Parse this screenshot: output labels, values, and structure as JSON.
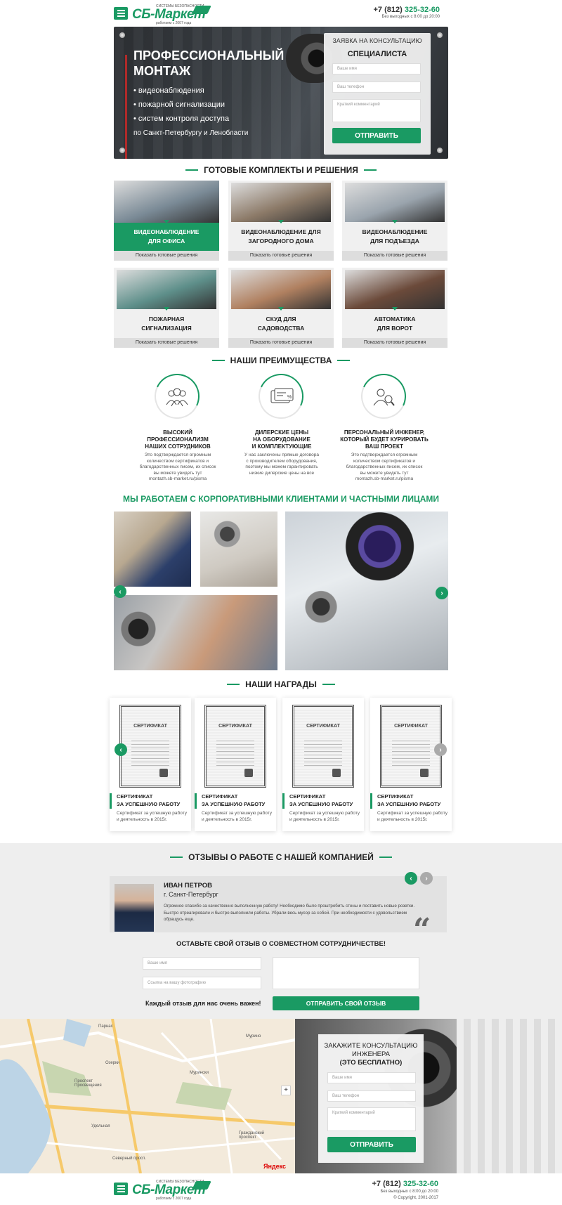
{
  "header": {
    "logo": {
      "name": "СБ-Маркет",
      "tagline_top": "СИСТЕМЫ БЕЗОПАСНОСТИ",
      "tagline_bottom": "работаем с 2007 года"
    },
    "phone_prefix": "+7 (812)",
    "phone_number": "325-32-60",
    "hours": "Без выходных с 8:00 до 20:00"
  },
  "hero": {
    "title": "ПРОФЕССИОНАЛЬНЫЙ МОНТАЖ",
    "list": [
      "• видеонаблюдения",
      "• пожарной сигнализации",
      "• систем контроля доступа"
    ],
    "region": "по Санкт-Петербургу и Ленобласти",
    "form": {
      "title_line1": "ЗАЯВКА НА КОНСУЛЬТАЦИЮ",
      "title_line2": "СПЕЦИАЛИСТА",
      "name_placeholder": "Ваше имя",
      "phone_placeholder": "Ваш телефон",
      "comment_placeholder": "Краткий комментарий",
      "submit": "ОТПРАВИТЬ"
    }
  },
  "solutions": {
    "title": "ГОТОВЫЕ КОМПЛЕКТЫ И РЕШЕНИЯ",
    "more_label": "Показать готовые решения",
    "cards": [
      {
        "line1": "ВИДЕОНАБЛЮДЕНИЕ",
        "line2": "ДЛЯ ОФИСА",
        "active": true,
        "color": "#7a8a96"
      },
      {
        "line1": "ВИДЕОНАБЛЮДЕНИЕ ДЛЯ",
        "line2": "ЗАГОРОДНОГО ДОМА",
        "active": false,
        "color": "#8c7a68"
      },
      {
        "line1": "ВИДЕОНАБЛЮДЕНИЕ",
        "line2": "ДЛЯ ПОДЪЕЗДА",
        "active": false,
        "color": "#9aa4ad"
      },
      {
        "line1": "ПОЖАРНАЯ",
        "line2": "СИГНАЛИЗАЦИЯ",
        "active": false,
        "color": "#5e8f8a"
      },
      {
        "line1": "СКУД ДЛЯ",
        "line2": "САДОВОДСТВА",
        "active": false,
        "color": "#b08060"
      },
      {
        "line1": "АВТОМАТИКА",
        "line2": "ДЛЯ ВОРОТ",
        "active": false,
        "color": "#6b4a3a"
      }
    ]
  },
  "advantages": {
    "title": "НАШИ ПРЕИМУЩЕСТВА",
    "items": [
      {
        "icon": "team-icon",
        "title": [
          "ВЫСОКИЙ",
          "ПРОФЕССИОНАЛИЗМ",
          "НАШИХ СОТРУДНИКОВ"
        ],
        "text": [
          "Это подтверждается огромным",
          "количеством сертификатов и",
          "благодарственных писем, их список",
          "вы можете увидеть тут",
          "montazh.sb-market.ru/pisma"
        ]
      },
      {
        "icon": "price-card-icon",
        "title": [
          "ДИЛЕРСКИЕ ЦЕНЫ",
          "НА  ОБОРУДОВАНИЕ",
          "И КОМПЛЕКТУЮЩИЕ"
        ],
        "text": [
          "У нас заключены прямые договора",
          "с производителем оборудования,",
          "поэтому мы можем гарантировать",
          "низкие дилерские цены на все"
        ]
      },
      {
        "icon": "engineer-search-icon",
        "title": [
          "ПЕРСОНАЛЬНЫЙ ИНЖЕНЕР,",
          "КОТОРЫЙ БУДЕТ КУРИРОВАТЬ",
          "ВАШ ПРОЕКТ"
        ],
        "text": [
          "Это подтверждается огромным",
          "количеством сертификатов и",
          "благодарственных писем, их список",
          "вы можете увидеть тут",
          "montazh.sb-market.ru/pisma"
        ]
      }
    ]
  },
  "clients": {
    "title": "МЫ РАБОТАЕМ С КОРПОРАТИВНЫМИ КЛИЕНТАМИ И ЧАСТНЫМИ ЛИЦАМИ"
  },
  "awards": {
    "title": "НАШИ НАГРАДЫ",
    "cert_heading": "СЕРТИФИКАТ",
    "items": [
      {
        "title1": "СЕРТИФИКАТ",
        "title2": "ЗА УСПЕШНУЮ РАБОТУ",
        "text1": "Сертификат за успешную работу",
        "text2": "и деятельность в 2015г."
      },
      {
        "title1": "СЕРТИФИКАТ",
        "title2": "ЗА УСПЕШНУЮ РАБОТУ",
        "text1": "Сертификат за успешную работу",
        "text2": "и деятельность в 2015г."
      },
      {
        "title1": "СЕРТИФИКАТ",
        "title2": "ЗА УСПЕШНУЮ РАБОТУ",
        "text1": "Сертификат за успешную работу",
        "text2": "и деятельность в 2015г."
      },
      {
        "title1": "СЕРТИФИКАТ",
        "title2": "ЗА УСПЕШНУЮ РАБОТУ",
        "text1": "Сертификат за успешную работу",
        "text2": "и деятельность в 2015г."
      }
    ]
  },
  "reviews": {
    "title": "ОТЗЫВЫ О РАБОТЕ С НАШЕЙ КОМПАНИЕЙ",
    "review": {
      "name": "ИВАН ПЕТРОВ",
      "city": "г. Санкт-Петербург",
      "text": [
        "Огромное спасибо за качественно выполненную работу! Необходимо было проштробить стены и поставить новые розетки.",
        "Быстро отреагировали и быстро выполнили работы. Убрали весь мусор за собой. При необходимости с удовольствием",
        "обращусь еще."
      ]
    },
    "form": {
      "title": "ОСТАВЬТЕ СВОЙ ОТЗЫВ О СОВМЕСТНОМ СОТРУДНИЧЕСТВЕ!",
      "name_placeholder": "Ваше имя",
      "photo_placeholder": "Ссылка на вашу фотографию",
      "note": "Каждый отзыв для нас очень важен!",
      "submit": "ОТПРАВИТЬ СВОЙ ОТЗЫВ"
    }
  },
  "cta": {
    "title_line1": "ЗАКАЖИТЕ КОНСУЛЬТАЦИЮ",
    "title_line2": "ИНЖЕНЕРА",
    "title_line3": "(ЭТО БЕСПЛАТНО)",
    "name_placeholder": "Ваше имя",
    "phone_placeholder": "Ваш телефон",
    "comment_placeholder": "Краткий комментарий",
    "submit": "ОТПРАВИТЬ"
  },
  "map": {
    "labels": [
      "Парнас",
      "Мурино",
      "Мурински",
      "Проспект Просвещения",
      "Озерки",
      "Удельная",
      "Гражданский проспект",
      "Северный просп.",
      "Яндекс"
    ]
  },
  "footer": {
    "phone_prefix": "+7 (812)",
    "phone_number": "325-32-60",
    "hours": "Без выходных с 8:00 до 20:00",
    "copyright": "© Copyright, 2001-2017"
  },
  "colors": {
    "accent": "#1a9a63",
    "dark": "#2d3034"
  }
}
